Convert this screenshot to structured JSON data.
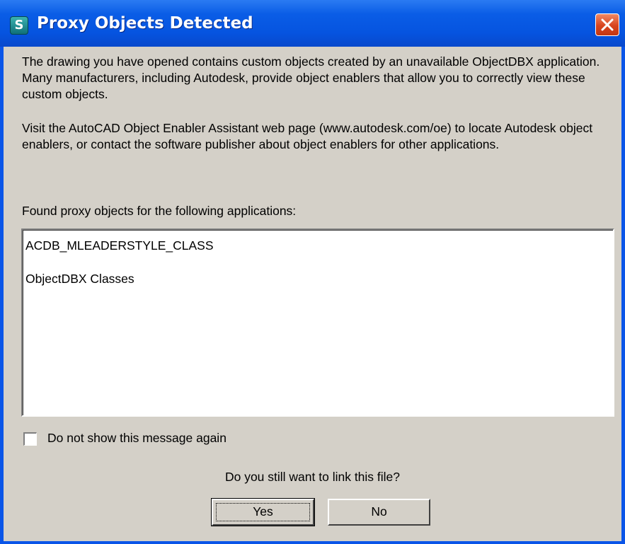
{
  "window": {
    "title": "Proxy Objects Detected",
    "icon": "app-s-icon",
    "icon_glyph": "S"
  },
  "message": {
    "para1": "The drawing you have opened contains custom objects created by an unavailable ObjectDBX application. Many manufacturers, including Autodesk, provide object enablers that allow you to correctly view these custom objects.",
    "para2": "Visit the AutoCAD Object Enabler Assistant web page (www.autodesk.com/oe) to locate Autodesk object enablers, or contact the software publisher about object enablers for other applications.",
    "found_label": "Found proxy objects for the following applications:"
  },
  "list": {
    "items": [
      "ACDB_MLEADERSTYLE_CLASS",
      "ObjectDBX Classes"
    ]
  },
  "checkbox": {
    "label": "Do not show this message again",
    "checked": false
  },
  "question": "Do you still want to link this file?",
  "buttons": {
    "yes": "Yes",
    "no": "No"
  },
  "colors": {
    "titlebar": "#0654e0",
    "client": "#d4d0c8",
    "close": "#d8441e"
  }
}
